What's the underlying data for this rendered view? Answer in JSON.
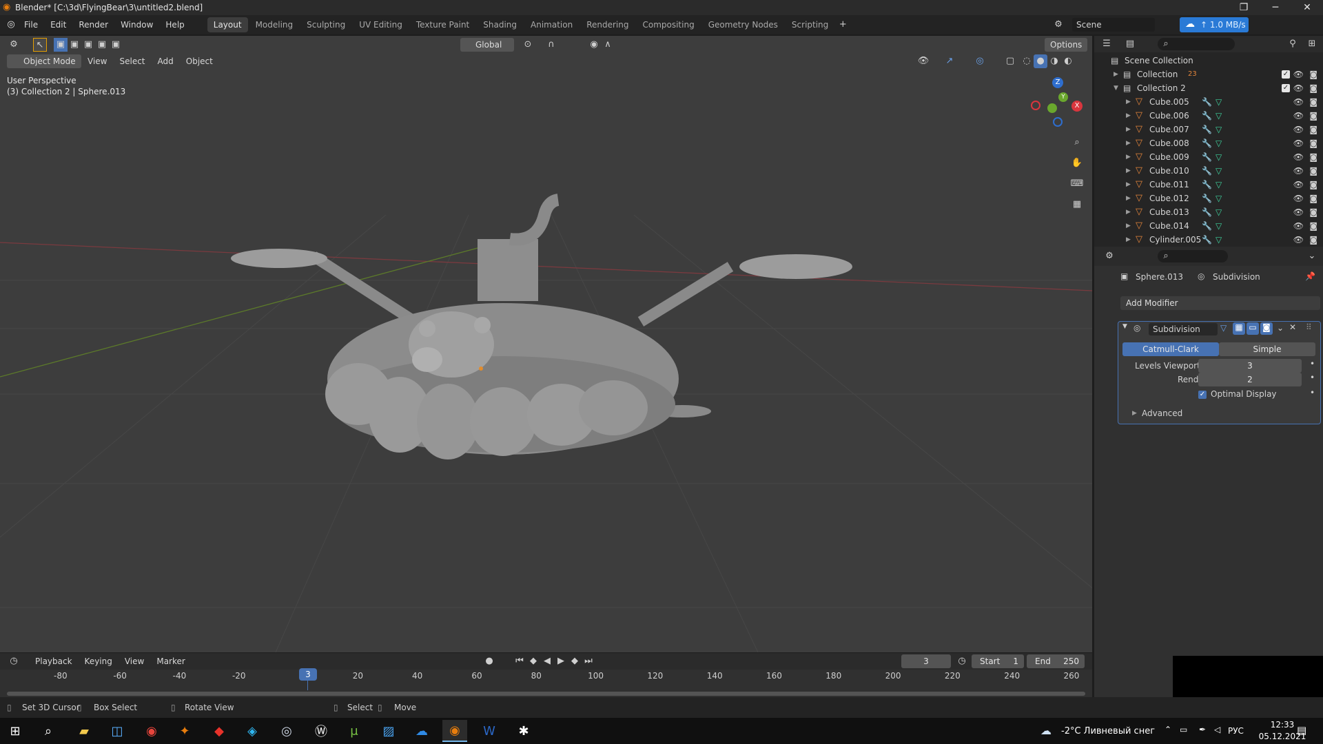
{
  "window": {
    "title": "Blender* [C:\\3d\\FlyingBear\\3\\untitled2.blend]"
  },
  "menus": [
    "File",
    "Edit",
    "Render",
    "Window",
    "Help"
  ],
  "workspaces": [
    "Layout",
    "Modeling",
    "Sculpting",
    "UV Editing",
    "Texture Paint",
    "Shading",
    "Animation",
    "Rendering",
    "Compositing",
    "Geometry Nodes",
    "Scripting"
  ],
  "active_workspace": "Layout",
  "scene": {
    "name": "Scene",
    "net_speed": "↑ 1.0 MB/s"
  },
  "viewport": {
    "mode": "Object Mode",
    "header_menus": [
      "View",
      "Select",
      "Add",
      "Object"
    ],
    "orientation": "Global",
    "options": "Options",
    "info_line1": "User Perspective",
    "info_line2": "(3) Collection 2 | Sphere.013",
    "gizmo": {
      "z": "Z",
      "y": "Y",
      "x": "X"
    }
  },
  "outliner": {
    "root": "Scene Collection",
    "collections": [
      {
        "name": "Collection",
        "badge": "23"
      },
      {
        "name": "Collection 2"
      }
    ],
    "objects": [
      {
        "name": "Cube.005"
      },
      {
        "name": "Cube.006"
      },
      {
        "name": "Cube.007"
      },
      {
        "name": "Cube.008"
      },
      {
        "name": "Cube.009"
      },
      {
        "name": "Cube.010"
      },
      {
        "name": "Cube.011"
      },
      {
        "name": "Cube.012"
      },
      {
        "name": "Cube.013"
      },
      {
        "name": "Cube.014"
      },
      {
        "name": "Cylinder.005"
      }
    ]
  },
  "properties": {
    "object": "Sphere.013",
    "modifier_crumb": "Subdivision",
    "add_modifier": "Add Modifier",
    "modifier": {
      "name": "Subdivision",
      "type_a": "Catmull-Clark",
      "type_b": "Simple",
      "levels_viewport_label": "Levels Viewport",
      "levels_viewport": "3",
      "render_label": "Render",
      "render": "2",
      "optimal_display": "Optimal Display",
      "advanced": "Advanced"
    }
  },
  "timeline": {
    "menus": [
      "Playback",
      "Keying",
      "View",
      "Marker"
    ],
    "current_frame": "3",
    "start_label": "Start",
    "start": "1",
    "end_label": "End",
    "end": "250",
    "ticks": [
      "-80",
      "-60",
      "-40",
      "-20",
      "3",
      "20",
      "40",
      "60",
      "80",
      "100",
      "120",
      "140",
      "160",
      "180",
      "200",
      "220",
      "240",
      "260"
    ]
  },
  "statusbar": {
    "items": [
      "Set 3D Cursor",
      "Box Select",
      "Rotate View",
      "Select",
      "Move"
    ]
  },
  "taskbar": {
    "weather": "-2°C  Ливневый снег",
    "lang": "РУС",
    "time": "12:33",
    "date": "05.12.2021"
  }
}
